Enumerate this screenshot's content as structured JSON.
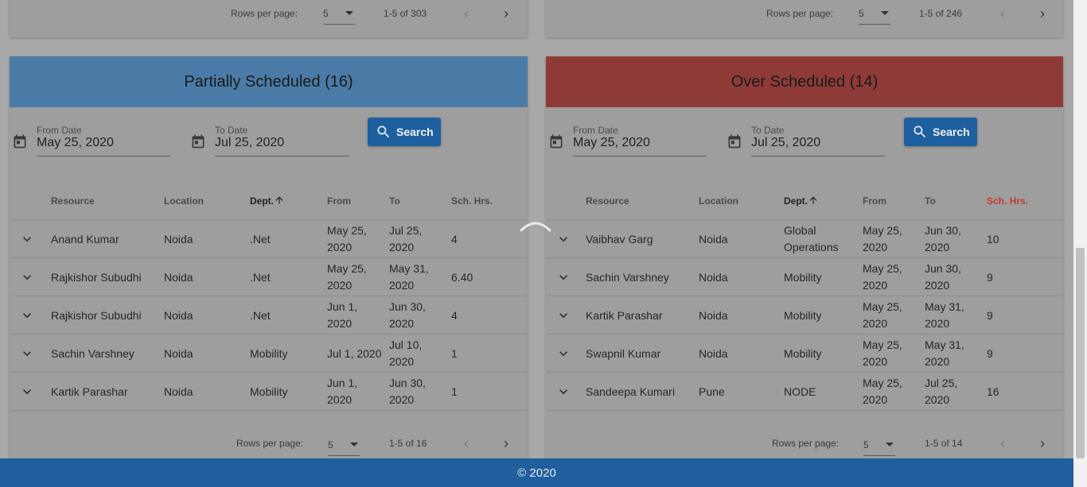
{
  "top_left": {
    "rpp_label": "Rows per page:",
    "rpp_value": "5",
    "range": "1-5 of 303"
  },
  "top_right": {
    "rpp_label": "Rows per page:",
    "rpp_value": "5",
    "range": "1-5 of 246"
  },
  "panels": [
    {
      "title": "Partially Scheduled (16)",
      "color": "#4a7ba7",
      "from_label": "From Date",
      "from_value": "May 25, 2020",
      "to_label": "To Date",
      "to_value": "Jul 25, 2020",
      "search_label": "Search",
      "columns": [
        "Resource",
        "Location",
        "Dept.",
        "From",
        "To",
        "Sch. Hrs."
      ],
      "rows": [
        [
          "Anand Kumar",
          "Noida",
          ".Net",
          "May 25, 2020",
          "Jul 25, 2020",
          "4"
        ],
        [
          "Rajkishor Subudhi",
          "Noida",
          ".Net",
          "May 25, 2020",
          "May 31, 2020",
          "6.40"
        ],
        [
          "Rajkishor Subudhi",
          "Noida",
          ".Net",
          "Jun 1, 2020",
          "Jun 30, 2020",
          "4"
        ],
        [
          "Sachin Varshney",
          "Noida",
          "Mobility",
          "Jul 1, 2020",
          "Jul 10, 2020",
          "1"
        ],
        [
          "Kartik Parashar",
          "Noida",
          "Mobility",
          "Jun 1, 2020",
          "Jun 30, 2020",
          "1"
        ]
      ],
      "paginator": {
        "rpp_label": "Rows per page:",
        "rpp_value": "5",
        "range": "1-5 of 16"
      }
    },
    {
      "title": "Over Scheduled (14)",
      "color": "#8e3b38",
      "from_label": "From Date",
      "from_value": "May 25, 2020",
      "to_label": "To Date",
      "to_value": "Jul 25, 2020",
      "search_label": "Search",
      "columns": [
        "Resource",
        "Location",
        "Dept.",
        "From",
        "To",
        "Sch. Hrs."
      ],
      "rows": [
        [
          "Vaibhav Garg",
          "Noida",
          "Global Operations",
          "May 25, 2020",
          "Jun 30, 2020",
          "10"
        ],
        [
          "Sachin Varshney",
          "Noida",
          "Mobility",
          "May 25, 2020",
          "Jun 30, 2020",
          "9"
        ],
        [
          "Kartik Parashar",
          "Noida",
          "Mobility",
          "May 25, 2020",
          "May 31, 2020",
          "9"
        ],
        [
          "Swapnil Kumar",
          "Noida",
          "Mobility",
          "May 25, 2020",
          "May 31, 2020",
          "9"
        ],
        [
          "Sandeepa Kumari",
          "Pune",
          "NODE",
          "May 25, 2020",
          "Jul 25, 2020",
          "16"
        ]
      ],
      "paginator": {
        "rpp_label": "Rows per page:",
        "rpp_value": "5",
        "range": "1-5 of 14"
      }
    }
  ],
  "footer": {
    "text": "© 2020"
  },
  "icons": {
    "calendar": "calendar-icon",
    "search": "search-icon",
    "expand": "chevron-down-icon",
    "sort": "arrow-up-icon",
    "prev": "chevron-left-icon",
    "next": "chevron-right-icon"
  },
  "accent": {
    "sch_hrs_highlight": "#c0392b"
  }
}
